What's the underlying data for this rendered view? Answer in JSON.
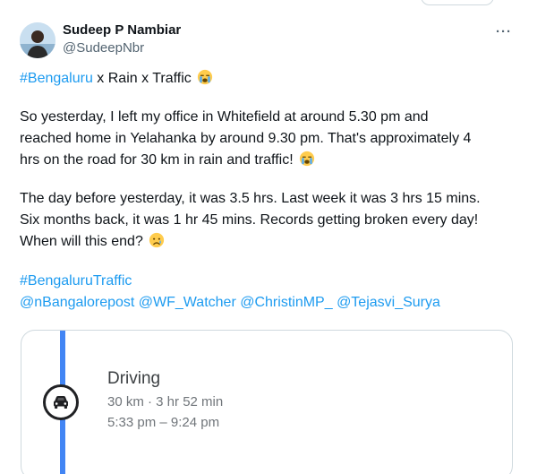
{
  "tweet": {
    "author": {
      "display_name": "Sudeep P Nambiar",
      "handle": "@SudeepNbr"
    },
    "more_label": "···",
    "line1": {
      "hashtag": "#Bengaluru",
      "text": " x Rain x Traffic "
    },
    "paragraph2": {
      "line1": "So yesterday, I left my office in Whitefield at around 5.30 pm and",
      "line2": "reached home in Yelahanka by around 9.30 pm. That's approximately 4",
      "line3": "hrs on the road for 30 km in rain and traffic! "
    },
    "paragraph3": {
      "line1": "The day before yesterday, it was 3.5 hrs. Last week it was 3 hrs 15 mins.",
      "line2": "Six months back, it was 1 hr 45 mins. Records getting broken every day!",
      "line3": "When will this end? "
    },
    "hashtag2": "#BengaluruTraffic",
    "mentions": [
      "@nBangalorepost",
      "@WF_Watcher",
      "@ChristinMP_",
      "@Tejasvi_Surya"
    ],
    "emojis": {
      "crying": "loudly-crying-face",
      "sad": "crying-face"
    }
  },
  "media": {
    "mode": "Driving",
    "distance_duration": "30 km · 3 hr 52 min",
    "time_range": "5:33 pm – 9:24 pm",
    "icon": "car-icon",
    "route_color": "#4285f4"
  },
  "colors": {
    "link": "#1d9bf0",
    "text": "#0f1419",
    "secondary": "#536471",
    "border": "#cfd9de"
  }
}
